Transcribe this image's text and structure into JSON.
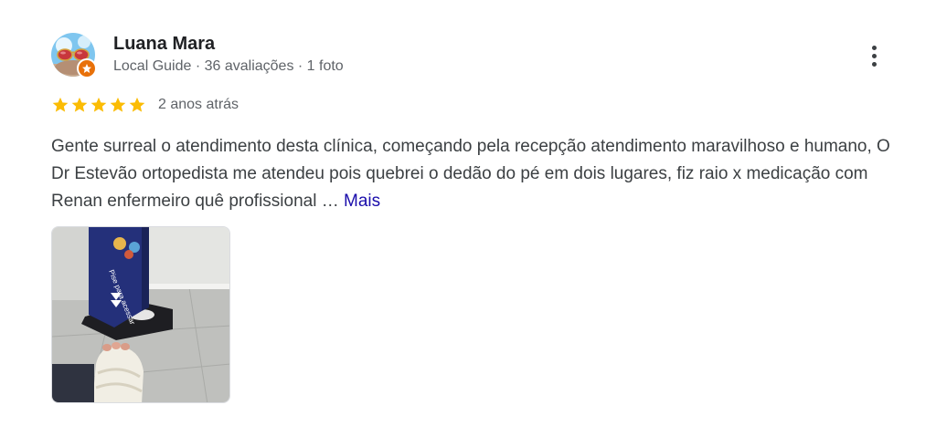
{
  "review": {
    "author_name": "Luana Mara",
    "author_meta": "Local Guide · 36 avaliações · 1 foto",
    "rating": 5,
    "rating_max": 5,
    "time_ago": "2 anos atrás",
    "text": "Gente surreal o atendimento desta clínica, começando pela recepção atendimento maravilhoso e humano, O Dr Estevão ortopedista me atendeu pois quebrei o dedão do pé em dois lugares, fiz raio x medicação com Renan enfermeiro quê profissional …",
    "more_label": "Mais",
    "photo_label": "Pise para acessar"
  },
  "colors": {
    "star": "#fbbc04",
    "badge": "#e8710a",
    "link": "#1a0dab",
    "meta_text": "#5f6368"
  },
  "icons": {
    "menu": "more-vert-icon",
    "star": "star-icon",
    "badge": "local-guide-badge-icon"
  }
}
